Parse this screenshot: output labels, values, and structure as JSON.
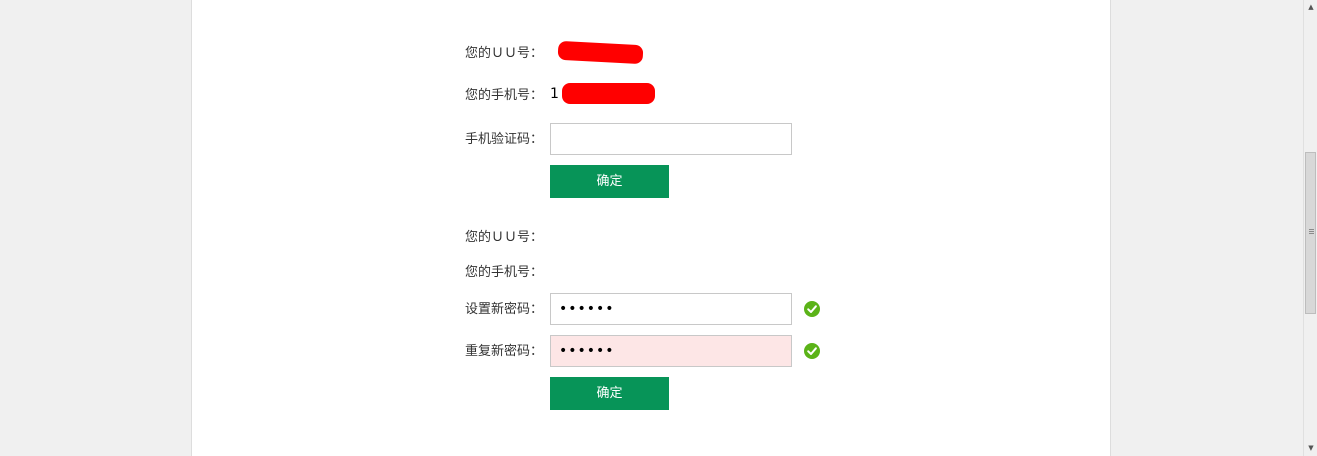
{
  "step1": {
    "uu_label": "您的ＵＵ号：",
    "phone_label": "您的手机号：",
    "phone_visible_prefix": "1",
    "code_label": "手机验证码：",
    "code_value": "",
    "confirm_label": "确定"
  },
  "step2": {
    "uu_label": "您的ＵＵ号：",
    "phone_label": "您的手机号：",
    "new_password_label": "设置新密码：",
    "new_password_value": "••••••",
    "repeat_password_label": "重复新密码：",
    "repeat_password_value": "••••••",
    "confirm_label": "确定"
  },
  "colors": {
    "button": "#079458",
    "check": "#5bb318",
    "error_field_bg": "#fde6e6",
    "redaction": "#ff0000"
  },
  "icons": {
    "valid": "check-circle-icon",
    "scroll_up": "triangle-up",
    "scroll_down": "triangle-down"
  }
}
